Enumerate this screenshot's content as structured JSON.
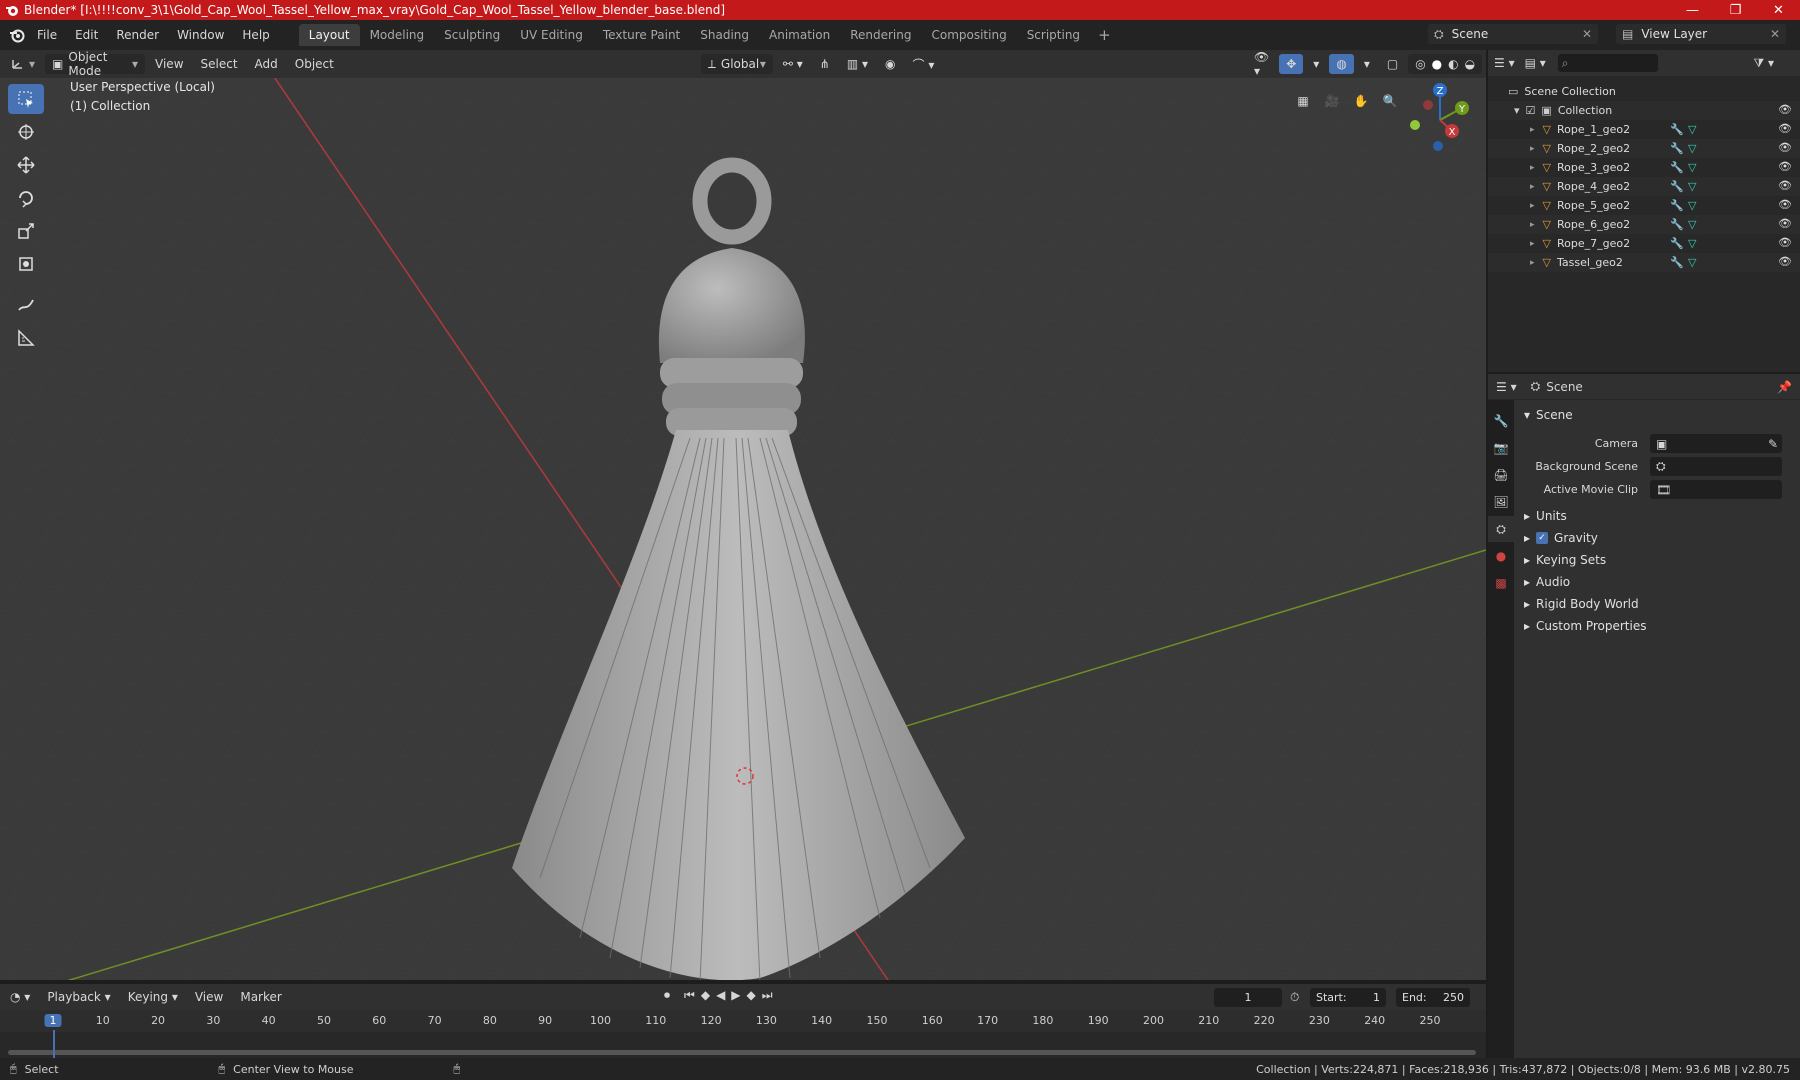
{
  "window": {
    "title": "Blender* [I:\\!!!!conv_3\\1\\Gold_Cap_Wool_Tassel_Yellow_max_vray\\Gold_Cap_Wool_Tassel_Yellow_blender_base.blend]",
    "controls": [
      "—",
      "❐",
      "✕"
    ]
  },
  "menu": [
    "File",
    "Edit",
    "Render",
    "Window",
    "Help"
  ],
  "workspaces": {
    "active": "Layout",
    "tabs": [
      "Layout",
      "Modeling",
      "Sculpting",
      "UV Editing",
      "Texture Paint",
      "Shading",
      "Animation",
      "Rendering",
      "Compositing",
      "Scripting"
    ],
    "add": "+"
  },
  "scene_selector": {
    "value": "Scene"
  },
  "view_layer_selector": {
    "value": "View Layer"
  },
  "viewport_header": {
    "mode": "Object Mode",
    "menus": [
      "View",
      "Select",
      "Add",
      "Object"
    ],
    "transform_orientation": "Global"
  },
  "viewport": {
    "info_line1": "User Perspective (Local)",
    "info_line2": "(1) Collection",
    "gizmo": {
      "z": "Z",
      "y": "Y",
      "x": "X"
    }
  },
  "outliner": {
    "root": "Scene Collection",
    "collection": "Collection",
    "objects": [
      "Rope_1_geo2",
      "Rope_2_geo2",
      "Rope_3_geo2",
      "Rope_4_geo2",
      "Rope_5_geo2",
      "Rope_6_geo2",
      "Rope_7_geo2",
      "Tassel_geo2"
    ]
  },
  "properties": {
    "header": "Scene",
    "panel": "Scene",
    "fields": [
      {
        "label": "Camera"
      },
      {
        "label": "Background Scene"
      },
      {
        "label": "Active Movie Clip"
      }
    ],
    "sections": [
      "Units",
      "Gravity",
      "Keying Sets",
      "Audio",
      "Rigid Body World",
      "Custom Properties"
    ],
    "gravity_checked": true
  },
  "timeline": {
    "menus": [
      "Playback",
      "Keying",
      "View",
      "Marker"
    ],
    "current_frame": "1",
    "start_label": "Start:",
    "start": "1",
    "end_label": "End:",
    "end": "250",
    "ruler": [
      "1",
      "10",
      "20",
      "30",
      "40",
      "50",
      "60",
      "70",
      "80",
      "90",
      "100",
      "110",
      "120",
      "130",
      "140",
      "150",
      "160",
      "170",
      "180",
      "190",
      "200",
      "210",
      "220",
      "230",
      "240",
      "250"
    ]
  },
  "statusbar": {
    "left1": "Select",
    "left2": "Center View to Mouse",
    "right": "Collection | Verts:224,871 | Faces:218,936 | Tris:437,872 | Objects:0/8 | Mem: 93.6 MB | v2.80.75"
  },
  "colors": {
    "titlebar": "#c3191b",
    "accent": "#4772b3",
    "x_axis": "#c43a3a",
    "y_axis": "#7a9a2a",
    "object_icon": "#e09a3a",
    "mesh_icon": "#34d1b0"
  }
}
